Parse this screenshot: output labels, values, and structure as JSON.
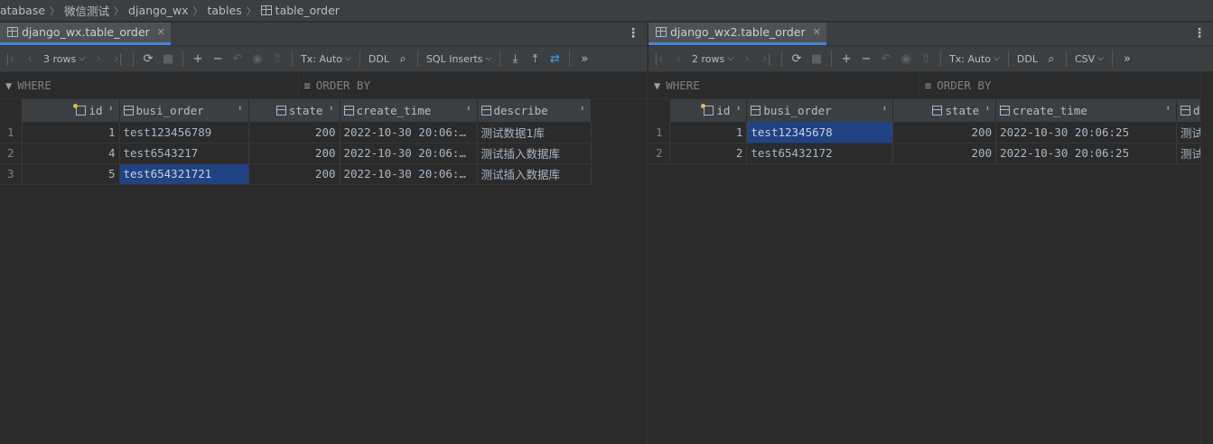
{
  "breadcrumb": {
    "items": [
      "atabase",
      "微信测试",
      "django_wx",
      "tables",
      "table_order"
    ]
  },
  "left": {
    "tab_label": "django_wx.table_order",
    "rows_label": "3 rows",
    "tx_label": "Tx: Auto",
    "ddl_label": "DDL",
    "extract_label": "SQL Inserts",
    "where_label": "WHERE",
    "orderby_label": "ORDER BY",
    "columns": [
      "id",
      "busi_order",
      "state",
      "create_time",
      "describe"
    ],
    "rows": [
      {
        "n": "1",
        "id": "1",
        "busi_order": "test123456789",
        "state": "200",
        "create_time": "2022-10-30 20:06:…",
        "describe": "测试数据1库"
      },
      {
        "n": "2",
        "id": "4",
        "busi_order": "test6543217",
        "state": "200",
        "create_time": "2022-10-30 20:06:…",
        "describe": "测试插入数据库"
      },
      {
        "n": "3",
        "id": "5",
        "busi_order": "test654321721",
        "state": "200",
        "create_time": "2022-10-30 20:06:…",
        "describe": "测试插入数据库"
      }
    ]
  },
  "right": {
    "tab_label": "django_wx2.table_order",
    "rows_label": "2 rows",
    "tx_label": "Tx: Auto",
    "ddl_label": "DDL",
    "extract_label": "CSV",
    "where_label": "WHERE",
    "orderby_label": "ORDER BY",
    "columns": [
      "id",
      "busi_order",
      "state",
      "create_time",
      "d"
    ],
    "rows": [
      {
        "n": "1",
        "id": "1",
        "busi_order": "test12345678",
        "state": "200",
        "create_time": "2022-10-30 20:06:25",
        "describe": "测试"
      },
      {
        "n": "2",
        "id": "2",
        "busi_order": "test65432172",
        "state": "200",
        "create_time": "2022-10-30 20:06:25",
        "describe": "测试"
      }
    ]
  },
  "colors": {
    "selection": "#214283",
    "tab_underline": "#4a88c7",
    "panel_bg": "#3c3f41",
    "editor_bg": "#2b2b2b"
  }
}
